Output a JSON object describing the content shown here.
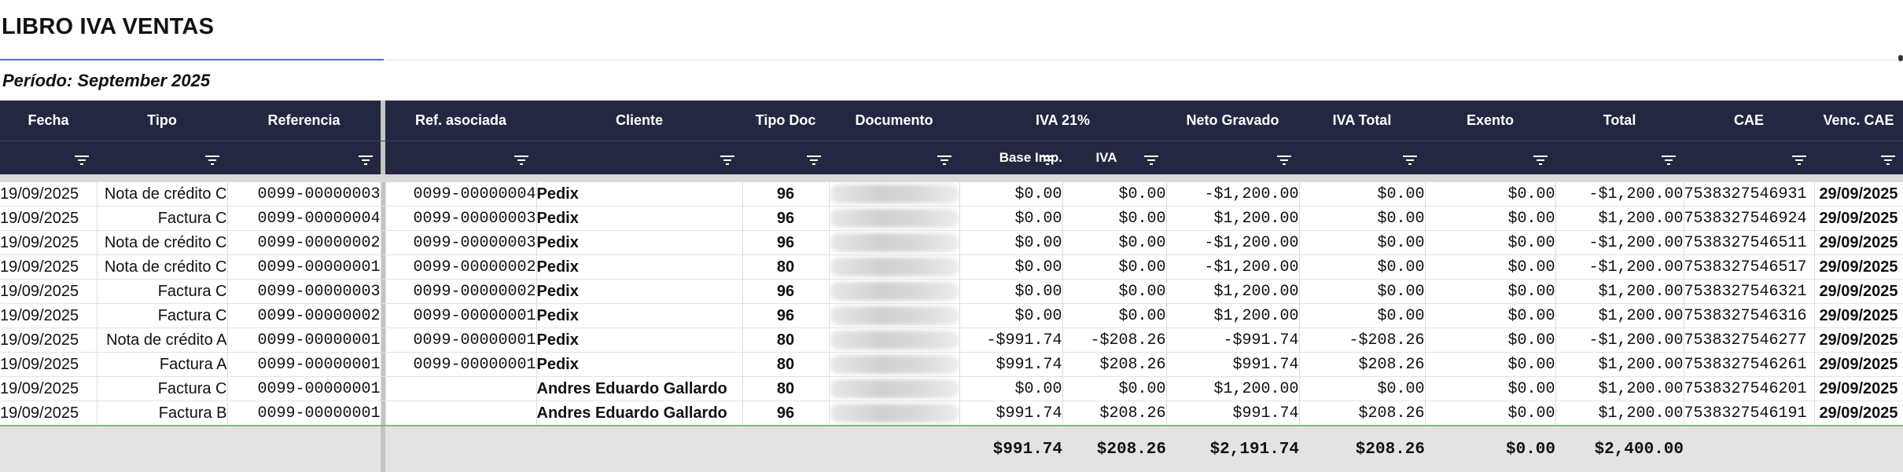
{
  "title": "LIBRO IVA VENTAS",
  "periodo": "Período: September 2025",
  "headers": {
    "fecha": "Fecha",
    "tipo": "Tipo",
    "referencia": "Referencia",
    "ref_asociada": "Ref. asociada",
    "cliente": "Cliente",
    "tipo_doc": "Tipo Doc",
    "documento": "Documento",
    "iva21": "IVA 21%",
    "neto_gravado": "Neto Gravado",
    "iva_total": "IVA Total",
    "exento": "Exento",
    "total": "Total",
    "cae": "CAE",
    "venc_cae": "Venc. CAE",
    "base_imp": "Base Imp.",
    "iva": "IVA"
  },
  "rows": [
    [
      "19/09/2025",
      "Nota de crédito C",
      "0099-00000003",
      "0099-00000004",
      "Pedix",
      "96",
      "$0.00",
      "$0.00",
      "-$1,200.00",
      "$0.00",
      "$0.00",
      "-$1,200.00",
      "7538327546931",
      "29/09/2025"
    ],
    [
      "19/09/2025",
      "Factura C",
      "0099-00000004",
      "0099-00000003",
      "Pedix",
      "96",
      "$0.00",
      "$0.00",
      "$1,200.00",
      "$0.00",
      "$0.00",
      "$1,200.00",
      "7538327546924",
      "29/09/2025"
    ],
    [
      "19/09/2025",
      "Nota de crédito C",
      "0099-00000002",
      "0099-00000003",
      "Pedix",
      "96",
      "$0.00",
      "$0.00",
      "-$1,200.00",
      "$0.00",
      "$0.00",
      "-$1,200.00",
      "7538327546511",
      "29/09/2025"
    ],
    [
      "19/09/2025",
      "Nota de crédito C",
      "0099-00000001",
      "0099-00000002",
      "Pedix",
      "80",
      "$0.00",
      "$0.00",
      "-$1,200.00",
      "$0.00",
      "$0.00",
      "-$1,200.00",
      "7538327546517",
      "29/09/2025"
    ],
    [
      "19/09/2025",
      "Factura C",
      "0099-00000003",
      "0099-00000002",
      "Pedix",
      "96",
      "$0.00",
      "$0.00",
      "$1,200.00",
      "$0.00",
      "$0.00",
      "$1,200.00",
      "7538327546321",
      "29/09/2025"
    ],
    [
      "19/09/2025",
      "Factura C",
      "0099-00000002",
      "0099-00000001",
      "Pedix",
      "96",
      "$0.00",
      "$0.00",
      "$1,200.00",
      "$0.00",
      "$0.00",
      "$1,200.00",
      "7538327546316",
      "29/09/2025"
    ],
    [
      "19/09/2025",
      "Nota de crédito A",
      "0099-00000001",
      "0099-00000001",
      "Pedix",
      "80",
      "-$991.74",
      "-$208.26",
      "-$991.74",
      "-$208.26",
      "$0.00",
      "-$1,200.00",
      "7538327546277",
      "29/09/2025"
    ],
    [
      "19/09/2025",
      "Factura A",
      "0099-00000001",
      "0099-00000001",
      "Pedix",
      "80",
      "$991.74",
      "$208.26",
      "$991.74",
      "$208.26",
      "$0.00",
      "$1,200.00",
      "7538327546261",
      "29/09/2025"
    ],
    [
      "19/09/2025",
      "Factura C",
      "0099-00000001",
      "",
      "Andres Eduardo Gallardo",
      "80",
      "$0.00",
      "$0.00",
      "$1,200.00",
      "$0.00",
      "$0.00",
      "$1,200.00",
      "7538327546201",
      "29/09/2025"
    ],
    [
      "19/09/2025",
      "Factura B",
      "0099-00000001",
      "",
      "Andres Eduardo Gallardo",
      "96",
      "$991.74",
      "$208.26",
      "$991.74",
      "$208.26",
      "$0.00",
      "$1,200.00",
      "7538327546191",
      "29/09/2025"
    ]
  ],
  "totals": {
    "base_imp": "$991.74",
    "iva": "$208.26",
    "neto_gravado": "$2,191.74",
    "iva_total": "$208.26",
    "exento": "$0.00",
    "total": "$2,400.00"
  },
  "colors": {
    "header_bg": "#232741",
    "title_rule": "#4a74c9",
    "totals_bg": "#e3e3e3"
  }
}
